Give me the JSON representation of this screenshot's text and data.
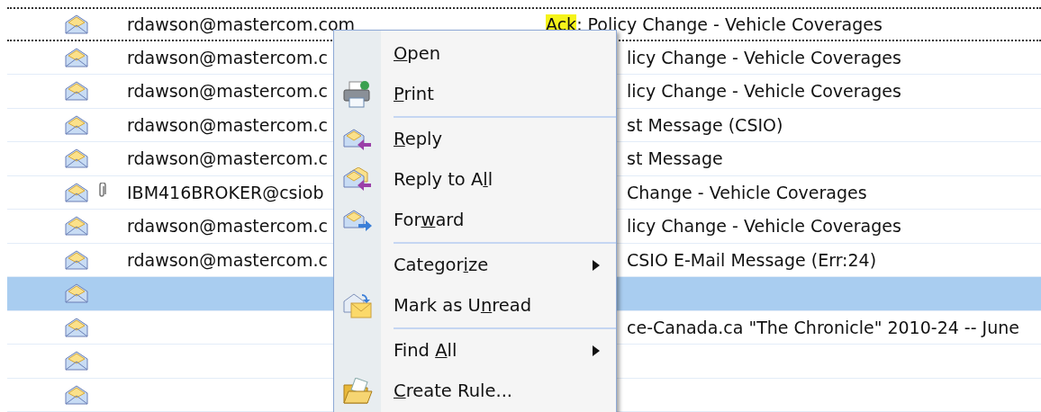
{
  "messages": [
    {
      "from": "rdawson@mastercom.com",
      "highlight": "Ack",
      "subject": ": Policy Change - Vehicle Coverages",
      "attachment": false,
      "selected": false,
      "focused": true
    },
    {
      "from": "rdawson@mastercom.c",
      "subject": "licy Change - Vehicle Coverages",
      "attachment": false,
      "selected": false,
      "focused": false
    },
    {
      "from": "rdawson@mastercom.c",
      "subject": "licy Change - Vehicle Coverages",
      "attachment": false,
      "selected": false,
      "focused": false
    },
    {
      "from": "rdawson@mastercom.c",
      "subject": "st Message (CSIO)",
      "attachment": false,
      "selected": false,
      "focused": false
    },
    {
      "from": "rdawson@mastercom.c",
      "subject": "st Message",
      "attachment": false,
      "selected": false,
      "focused": false
    },
    {
      "from": "IBM416BROKER@csiob",
      "subject": "Change - Vehicle Coverages",
      "attachment": true,
      "selected": false,
      "focused": false
    },
    {
      "from": "rdawson@mastercom.c",
      "subject": "licy Change - Vehicle Coverages",
      "attachment": false,
      "selected": false,
      "focused": false
    },
    {
      "from": "rdawson@mastercom.c",
      "subject": "CSIO E-Mail Message (Err:24)",
      "attachment": false,
      "selected": false,
      "focused": false
    },
    {
      "attachment": false,
      "selected": true,
      "focused": false
    },
    {
      "subject": "ce-Canada.ca \"The Chronicle\" 2010-24 -- June",
      "attachment": false,
      "selected": false,
      "focused": false
    },
    {
      "attachment": false,
      "selected": false,
      "focused": false
    },
    {
      "attachment": false,
      "selected": false,
      "focused": false
    }
  ],
  "context_menu": [
    {
      "kind": "item",
      "key": "O",
      "after": "pen",
      "submenu": false
    },
    {
      "kind": "item",
      "key": "P",
      "after": "rint",
      "submenu": false
    },
    {
      "kind": "separator"
    },
    {
      "kind": "item",
      "key": "R",
      "after": "eply",
      "submenu": false
    },
    {
      "kind": "item",
      "before": "Reply to A",
      "key": "l",
      "after": "l",
      "submenu": false
    },
    {
      "kind": "item",
      "before": "For",
      "key": "w",
      "after": "ard",
      "submenu": false
    },
    {
      "kind": "separator"
    },
    {
      "kind": "item",
      "before": "Categor",
      "key": "i",
      "after": "ze",
      "submenu": true
    },
    {
      "kind": "item",
      "before": "Mark as U",
      "key": "n",
      "after": "read",
      "submenu": false
    },
    {
      "kind": "separator"
    },
    {
      "kind": "item",
      "before": "Find ",
      "key": "A",
      "after": "ll",
      "submenu": true
    },
    {
      "kind": "item",
      "key": "C",
      "after": "reate Rule...",
      "submenu": false
    }
  ]
}
